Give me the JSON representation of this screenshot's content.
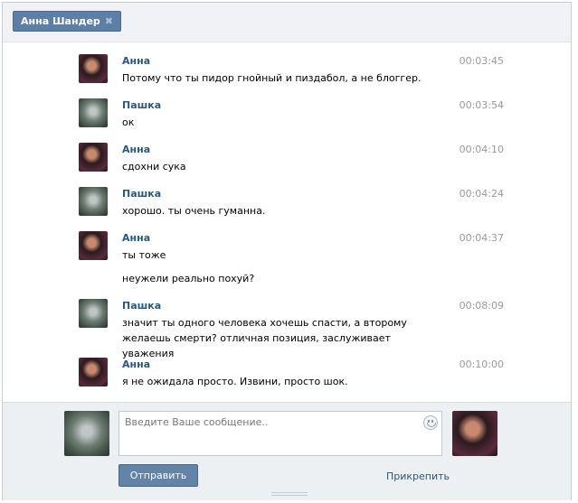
{
  "tab": {
    "title": "Анна Шандер",
    "close_icon": "close-icon"
  },
  "messages": [
    {
      "author": "Анна",
      "avatar": "anna",
      "time": "00:03:45",
      "lines": [
        "Потому что ты пидор гнойный и пиздабол, а не блоггер."
      ]
    },
    {
      "author": "Пашка",
      "avatar": "pashka",
      "time": "00:03:54",
      "lines": [
        "ок"
      ]
    },
    {
      "author": "Анна",
      "avatar": "anna",
      "time": "00:04:10",
      "lines": [
        "сдохни сука"
      ]
    },
    {
      "author": "Пашка",
      "avatar": "pashka",
      "time": "00:04:24",
      "lines": [
        "хорошо. ты очень гуманна."
      ]
    },
    {
      "author": "Анна",
      "avatar": "anna",
      "time": "00:04:37",
      "lines": [
        "ты тоже",
        "неужели реально похуй?"
      ]
    },
    {
      "author": "Пашка",
      "avatar": "pashka",
      "time": "00:08:09",
      "lines": [
        "значит ты одного человека хочешь спасти, а второму желаешь смерти? отличная позиция, заслуживает уважения"
      ]
    },
    {
      "author": "Анна",
      "avatar": "anna",
      "time": "00:10:00",
      "lines": [
        "я не ожидала просто. Извини, просто шок."
      ]
    }
  ],
  "composer": {
    "placeholder": "Введите Ваше сообщение..",
    "send_label": "Отправить",
    "attach_label": "Прикрепить"
  },
  "colors": {
    "accent": "#5b7fa6",
    "name_link": "#2b587a",
    "time": "#999999"
  }
}
